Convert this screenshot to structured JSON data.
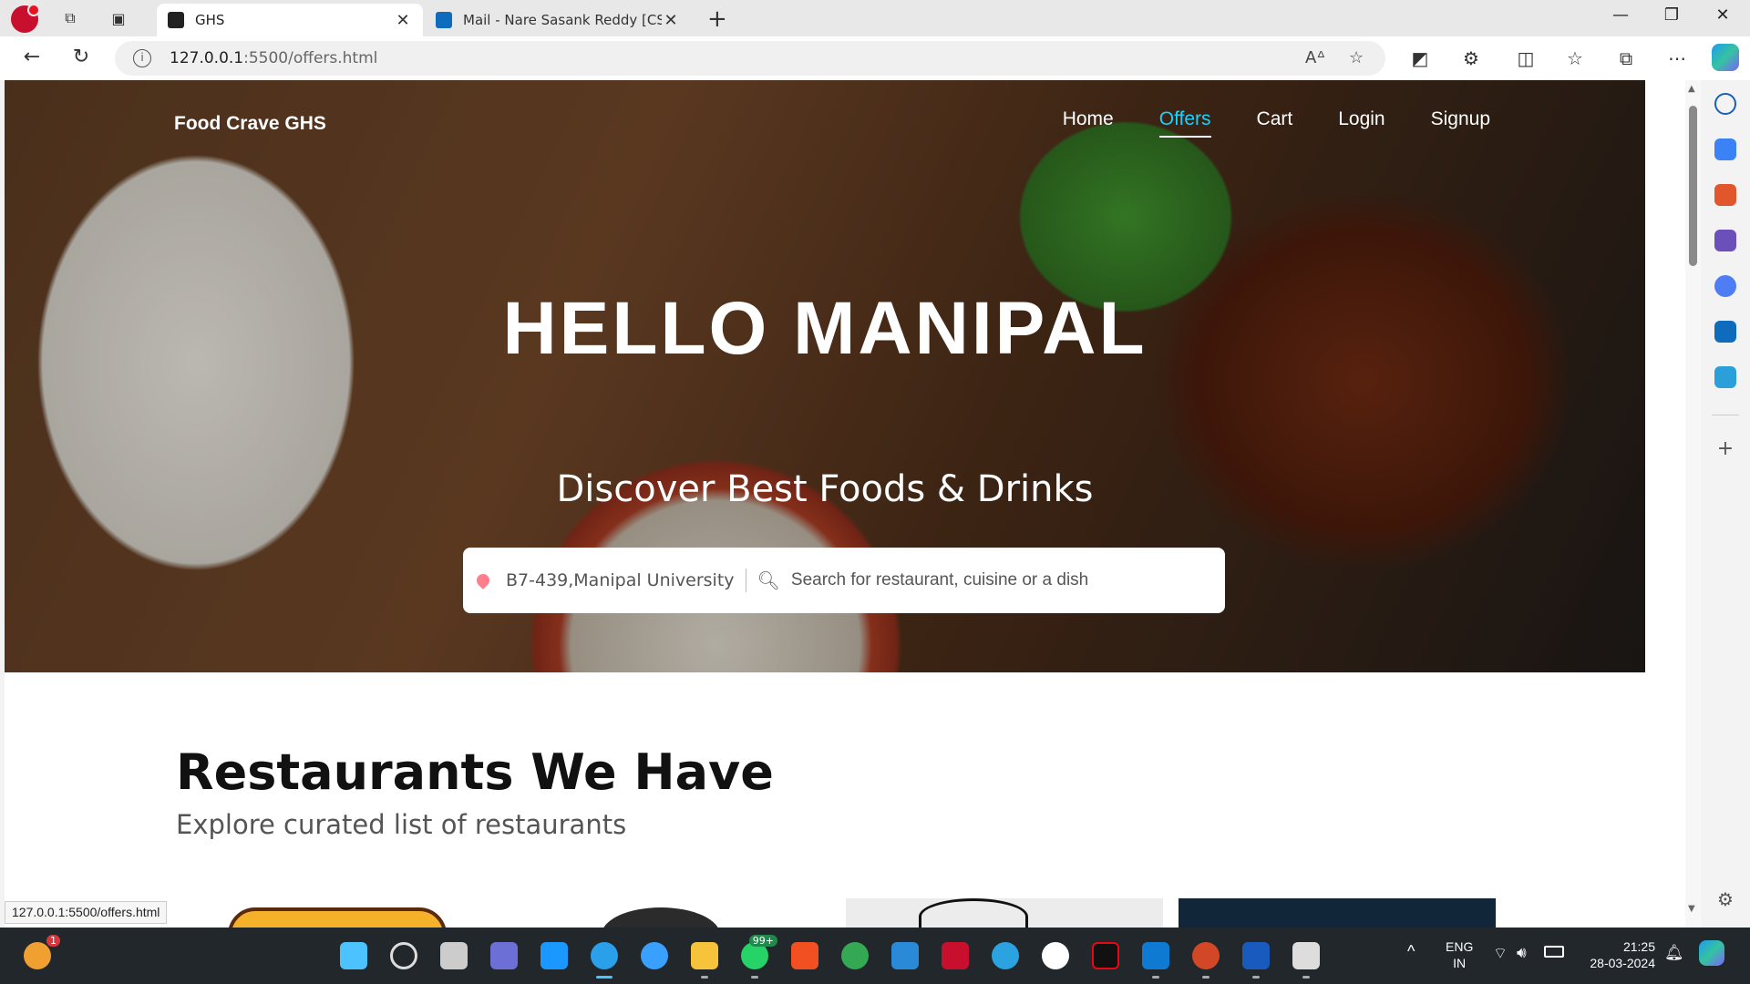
{
  "browser": {
    "tabs": [
      {
        "title": "GHS",
        "active": true
      },
      {
        "title": "Mail - Nare Sasank Reddy [CSE -",
        "active": false
      }
    ],
    "url_host": "127.0.0.1",
    "url_path": ":5500/offers.html",
    "status_url": "127.0.0.1:5500/offers.html"
  },
  "site": {
    "brand": "Food Crave GHS",
    "nav": [
      "Home",
      "Offers",
      "Cart",
      "Login",
      "Signup"
    ],
    "active_nav": "Offers",
    "hero_title": "HELLO MANIPAL",
    "hero_subtitle": "Discover Best Foods & Drinks",
    "location": "B7-439,Manipal University",
    "search_placeholder": "Search for restaurant, cuisine or a dish",
    "section_title": "Restaurants We Have",
    "section_subtitle": "Explore curated list of restaurants"
  },
  "taskbar": {
    "notification_count": "1",
    "whatsapp_badge": "99+",
    "lang_line1": "ENG",
    "lang_line2": "IN",
    "time": "21:25",
    "date": "28-03-2024"
  },
  "colors": {
    "accent_nav": "#1bd1ff",
    "taskbar_bg": "#21272b"
  }
}
